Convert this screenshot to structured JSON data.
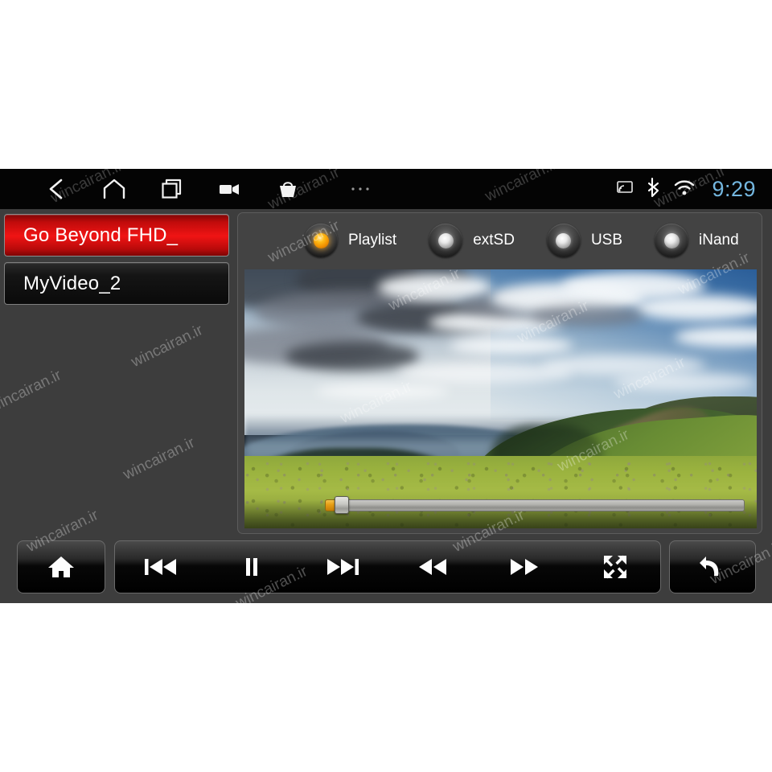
{
  "statusbar": {
    "nav_icons": [
      {
        "name": "back-icon",
        "label": "Back"
      },
      {
        "name": "home-icon",
        "label": "Home"
      },
      {
        "name": "recents-icon",
        "label": "Recent apps"
      },
      {
        "name": "camera-icon",
        "label": "Camera"
      },
      {
        "name": "basket-icon",
        "label": "Apps"
      },
      {
        "name": "more-icon",
        "label": "More"
      }
    ],
    "sys_icons": [
      {
        "name": "cast-icon",
        "label": "Cast"
      },
      {
        "name": "bluetooth-icon",
        "label": "Bluetooth"
      },
      {
        "name": "wifi-icon",
        "label": "Wi-Fi"
      }
    ],
    "clock": "9:29",
    "clock_color": "#74b7e0",
    "background_color": "#040404"
  },
  "playlist": {
    "tracks": [
      {
        "title": "Go Beyond FHD_",
        "selected": true
      },
      {
        "title": "MyVideo_2",
        "selected": false
      }
    ],
    "selected_color": "#f01414",
    "panel_color": "#3d3d3d"
  },
  "sources": {
    "options": [
      {
        "label": "Playlist",
        "selected": true
      },
      {
        "label": "extSD",
        "selected": false
      },
      {
        "label": "USB",
        "selected": false
      },
      {
        "label": "iNand",
        "selected": false
      }
    ],
    "selected_indicator_color": "#ffbb16"
  },
  "video": {
    "scene_description": "Mountain landscape with dramatic clouds, green alpine ridges and a wildflower meadow",
    "seek_progress_percent": 2
  },
  "controls": {
    "home_group": [
      {
        "name": "home-button",
        "label": "Home",
        "icon": "home-icon"
      }
    ],
    "media_group": [
      {
        "name": "previous-track-button",
        "label": "Previous",
        "icon": "previous-track-icon"
      },
      {
        "name": "pause-button",
        "label": "Pause",
        "icon": "pause-icon"
      },
      {
        "name": "next-track-button",
        "label": "Next",
        "icon": "next-track-icon"
      },
      {
        "name": "rewind-button",
        "label": "Rewind",
        "icon": "rewind-icon"
      },
      {
        "name": "fast-forward-button",
        "label": "Fast forward",
        "icon": "fast-forward-icon"
      },
      {
        "name": "fullscreen-button",
        "label": "Fullscreen",
        "icon": "fullscreen-icon"
      }
    ],
    "back_group": [
      {
        "name": "return-button",
        "label": "Return",
        "icon": "return-icon"
      }
    ]
  },
  "watermark": {
    "text": "wincairan.ir"
  }
}
